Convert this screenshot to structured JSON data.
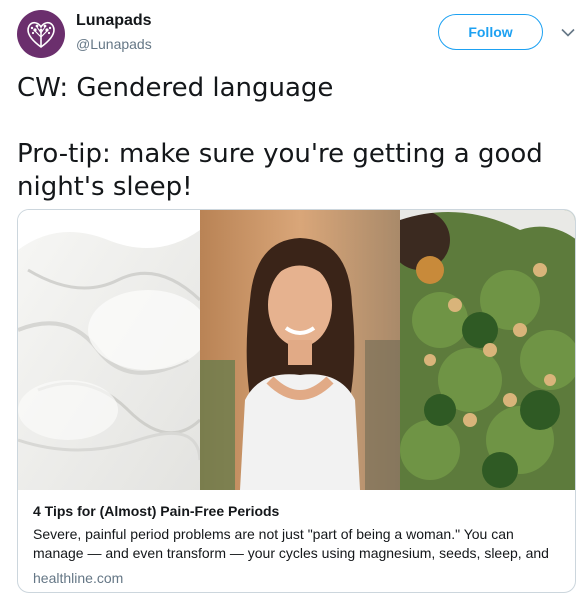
{
  "account": {
    "display_name": "Lunapads",
    "handle": "@Lunapads",
    "avatar_icon": "tree-heart-logo",
    "avatar_color": "#6b2f6d"
  },
  "actions": {
    "follow_label": "Follow",
    "menu_icon": "chevron-down-icon"
  },
  "tweet": {
    "line1": "CW: Gendered language",
    "line2": "Pro-tip: make sure you're getting a good night's sleep!"
  },
  "card": {
    "images": [
      "white-bedsheets-photo",
      "smiling-woman-photo",
      "kale-chickpea-salad-photo"
    ],
    "title": "4 Tips for (Almost) Pain-Free Periods",
    "description_line1": "Severe, painful period problems are not just \"part of being a woman.\" You can",
    "description_line2": "manage — and even transform — your cycles using magnesium, seeds, sleep, and",
    "domain": "healthline.com"
  },
  "colors": {
    "accent": "#1da1f2",
    "secondary_text": "#657786",
    "border": "#ccd6dd"
  }
}
